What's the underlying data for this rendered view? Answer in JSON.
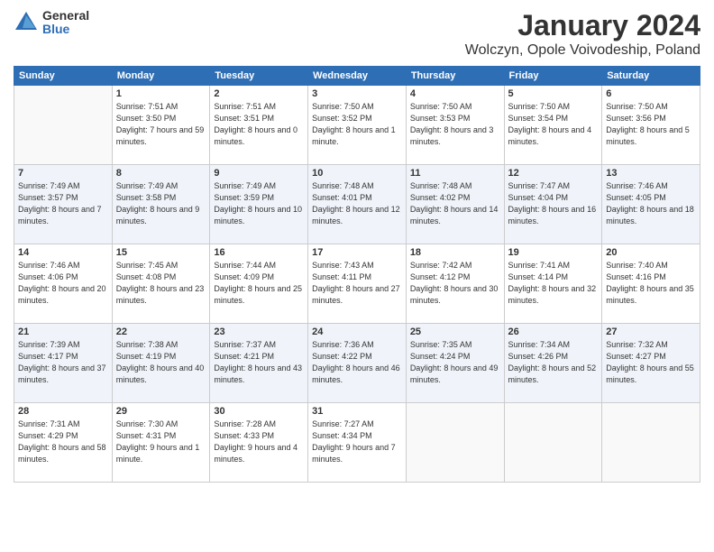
{
  "header": {
    "logo_general": "General",
    "logo_blue": "Blue",
    "month": "January 2024",
    "location": "Wolczyn, Opole Voivodeship, Poland"
  },
  "weekdays": [
    "Sunday",
    "Monday",
    "Tuesday",
    "Wednesday",
    "Thursday",
    "Friday",
    "Saturday"
  ],
  "weeks": [
    [
      {
        "day": "",
        "sunrise": "",
        "sunset": "",
        "daylight": ""
      },
      {
        "day": "1",
        "sunrise": "Sunrise: 7:51 AM",
        "sunset": "Sunset: 3:50 PM",
        "daylight": "Daylight: 7 hours and 59 minutes."
      },
      {
        "day": "2",
        "sunrise": "Sunrise: 7:51 AM",
        "sunset": "Sunset: 3:51 PM",
        "daylight": "Daylight: 8 hours and 0 minutes."
      },
      {
        "day": "3",
        "sunrise": "Sunrise: 7:50 AM",
        "sunset": "Sunset: 3:52 PM",
        "daylight": "Daylight: 8 hours and 1 minute."
      },
      {
        "day": "4",
        "sunrise": "Sunrise: 7:50 AM",
        "sunset": "Sunset: 3:53 PM",
        "daylight": "Daylight: 8 hours and 3 minutes."
      },
      {
        "day": "5",
        "sunrise": "Sunrise: 7:50 AM",
        "sunset": "Sunset: 3:54 PM",
        "daylight": "Daylight: 8 hours and 4 minutes."
      },
      {
        "day": "6",
        "sunrise": "Sunrise: 7:50 AM",
        "sunset": "Sunset: 3:56 PM",
        "daylight": "Daylight: 8 hours and 5 minutes."
      }
    ],
    [
      {
        "day": "7",
        "sunrise": "Sunrise: 7:49 AM",
        "sunset": "Sunset: 3:57 PM",
        "daylight": "Daylight: 8 hours and 7 minutes."
      },
      {
        "day": "8",
        "sunrise": "Sunrise: 7:49 AM",
        "sunset": "Sunset: 3:58 PM",
        "daylight": "Daylight: 8 hours and 9 minutes."
      },
      {
        "day": "9",
        "sunrise": "Sunrise: 7:49 AM",
        "sunset": "Sunset: 3:59 PM",
        "daylight": "Daylight: 8 hours and 10 minutes."
      },
      {
        "day": "10",
        "sunrise": "Sunrise: 7:48 AM",
        "sunset": "Sunset: 4:01 PM",
        "daylight": "Daylight: 8 hours and 12 minutes."
      },
      {
        "day": "11",
        "sunrise": "Sunrise: 7:48 AM",
        "sunset": "Sunset: 4:02 PM",
        "daylight": "Daylight: 8 hours and 14 minutes."
      },
      {
        "day": "12",
        "sunrise": "Sunrise: 7:47 AM",
        "sunset": "Sunset: 4:04 PM",
        "daylight": "Daylight: 8 hours and 16 minutes."
      },
      {
        "day": "13",
        "sunrise": "Sunrise: 7:46 AM",
        "sunset": "Sunset: 4:05 PM",
        "daylight": "Daylight: 8 hours and 18 minutes."
      }
    ],
    [
      {
        "day": "14",
        "sunrise": "Sunrise: 7:46 AM",
        "sunset": "Sunset: 4:06 PM",
        "daylight": "Daylight: 8 hours and 20 minutes."
      },
      {
        "day": "15",
        "sunrise": "Sunrise: 7:45 AM",
        "sunset": "Sunset: 4:08 PM",
        "daylight": "Daylight: 8 hours and 23 minutes."
      },
      {
        "day": "16",
        "sunrise": "Sunrise: 7:44 AM",
        "sunset": "Sunset: 4:09 PM",
        "daylight": "Daylight: 8 hours and 25 minutes."
      },
      {
        "day": "17",
        "sunrise": "Sunrise: 7:43 AM",
        "sunset": "Sunset: 4:11 PM",
        "daylight": "Daylight: 8 hours and 27 minutes."
      },
      {
        "day": "18",
        "sunrise": "Sunrise: 7:42 AM",
        "sunset": "Sunset: 4:12 PM",
        "daylight": "Daylight: 8 hours and 30 minutes."
      },
      {
        "day": "19",
        "sunrise": "Sunrise: 7:41 AM",
        "sunset": "Sunset: 4:14 PM",
        "daylight": "Daylight: 8 hours and 32 minutes."
      },
      {
        "day": "20",
        "sunrise": "Sunrise: 7:40 AM",
        "sunset": "Sunset: 4:16 PM",
        "daylight": "Daylight: 8 hours and 35 minutes."
      }
    ],
    [
      {
        "day": "21",
        "sunrise": "Sunrise: 7:39 AM",
        "sunset": "Sunset: 4:17 PM",
        "daylight": "Daylight: 8 hours and 37 minutes."
      },
      {
        "day": "22",
        "sunrise": "Sunrise: 7:38 AM",
        "sunset": "Sunset: 4:19 PM",
        "daylight": "Daylight: 8 hours and 40 minutes."
      },
      {
        "day": "23",
        "sunrise": "Sunrise: 7:37 AM",
        "sunset": "Sunset: 4:21 PM",
        "daylight": "Daylight: 8 hours and 43 minutes."
      },
      {
        "day": "24",
        "sunrise": "Sunrise: 7:36 AM",
        "sunset": "Sunset: 4:22 PM",
        "daylight": "Daylight: 8 hours and 46 minutes."
      },
      {
        "day": "25",
        "sunrise": "Sunrise: 7:35 AM",
        "sunset": "Sunset: 4:24 PM",
        "daylight": "Daylight: 8 hours and 49 minutes."
      },
      {
        "day": "26",
        "sunrise": "Sunrise: 7:34 AM",
        "sunset": "Sunset: 4:26 PM",
        "daylight": "Daylight: 8 hours and 52 minutes."
      },
      {
        "day": "27",
        "sunrise": "Sunrise: 7:32 AM",
        "sunset": "Sunset: 4:27 PM",
        "daylight": "Daylight: 8 hours and 55 minutes."
      }
    ],
    [
      {
        "day": "28",
        "sunrise": "Sunrise: 7:31 AM",
        "sunset": "Sunset: 4:29 PM",
        "daylight": "Daylight: 8 hours and 58 minutes."
      },
      {
        "day": "29",
        "sunrise": "Sunrise: 7:30 AM",
        "sunset": "Sunset: 4:31 PM",
        "daylight": "Daylight: 9 hours and 1 minute."
      },
      {
        "day": "30",
        "sunrise": "Sunrise: 7:28 AM",
        "sunset": "Sunset: 4:33 PM",
        "daylight": "Daylight: 9 hours and 4 minutes."
      },
      {
        "day": "31",
        "sunrise": "Sunrise: 7:27 AM",
        "sunset": "Sunset: 4:34 PM",
        "daylight": "Daylight: 9 hours and 7 minutes."
      },
      {
        "day": "",
        "sunrise": "",
        "sunset": "",
        "daylight": ""
      },
      {
        "day": "",
        "sunrise": "",
        "sunset": "",
        "daylight": ""
      },
      {
        "day": "",
        "sunrise": "",
        "sunset": "",
        "daylight": ""
      }
    ]
  ]
}
